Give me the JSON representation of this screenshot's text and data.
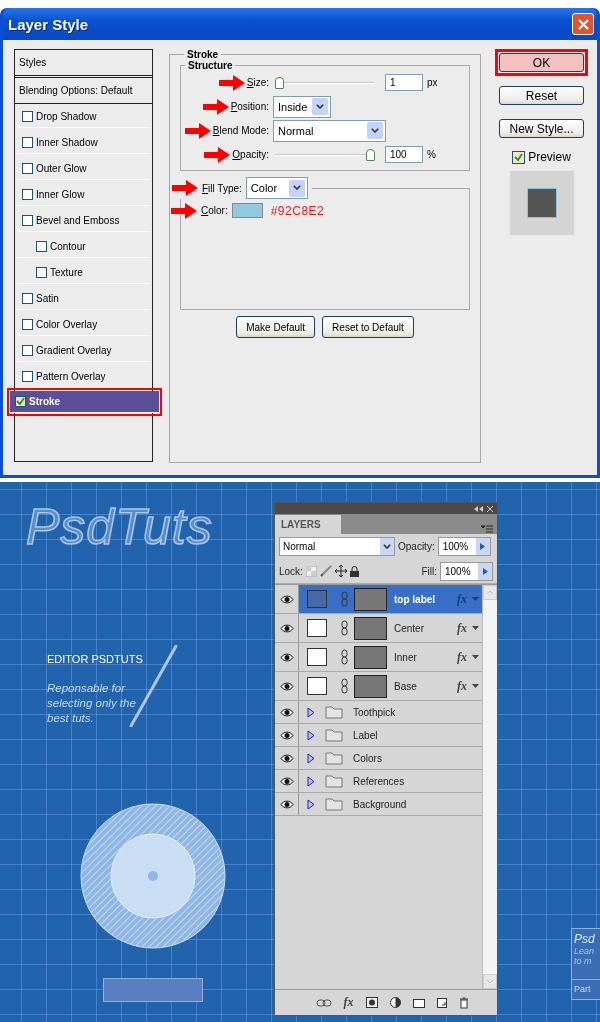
{
  "dialog": {
    "title": "Layer Style",
    "styles_header": "Styles",
    "blending": "Blending Options: Default",
    "effects": [
      {
        "label": "Drop Shadow",
        "checked": false,
        "selected": false,
        "highlighted": false
      },
      {
        "label": "Inner Shadow",
        "checked": false,
        "selected": false,
        "highlighted": false
      },
      {
        "label": "Outer Glow",
        "checked": false,
        "selected": false,
        "highlighted": false
      },
      {
        "label": "Inner Glow",
        "checked": false,
        "selected": false,
        "highlighted": false
      },
      {
        "label": "Bevel and Emboss",
        "checked": false,
        "selected": false,
        "highlighted": false,
        "children": [
          {
            "label": "Contour",
            "checked": false,
            "selected": false,
            "highlighted": false
          },
          {
            "label": "Texture",
            "checked": false,
            "selected": false,
            "highlighted": false
          }
        ]
      },
      {
        "label": "Satin",
        "checked": false,
        "selected": false,
        "highlighted": false
      },
      {
        "label": "Color Overlay",
        "checked": false,
        "selected": false,
        "highlighted": false
      },
      {
        "label": "Gradient Overlay",
        "checked": false,
        "selected": false,
        "highlighted": false
      },
      {
        "label": "Pattern Overlay",
        "checked": false,
        "selected": false,
        "highlighted": false
      },
      {
        "label": "Stroke",
        "checked": true,
        "selected": true,
        "highlighted": true
      }
    ],
    "stroke": {
      "title": "Stroke",
      "structure": "Structure",
      "size": {
        "label": "Size:",
        "value": "1",
        "unit": "px",
        "level": 0
      },
      "position": {
        "label": "Position:",
        "value": "Inside"
      },
      "blend_mode": {
        "label": "Blend Mode:",
        "value": "Normal"
      },
      "opacity": {
        "label": "Opacity:",
        "value": "100",
        "unit": "%",
        "level": 1
      },
      "fill_type": {
        "label": "Fill Type:",
        "value": "Color"
      },
      "color": {
        "label": "Color:",
        "color": "#92c8e2",
        "note": "#92C8E2"
      }
    },
    "bottom_buttons": [
      "Make Default",
      "Reset to Default"
    ],
    "side_buttons": [
      {
        "label": "OK",
        "highlighted": true
      },
      {
        "label": "Reset",
        "highlighted": false
      },
      {
        "label": "New Style...",
        "highlighted": false
      }
    ],
    "preview": {
      "label": "Preview",
      "checked": true
    }
  },
  "canvas": {
    "logo": "PsdTuts",
    "editor_title": "EDITOR PSDTUTS",
    "editor_text": "Reponsable for selecting only the best tuts.",
    "card": {
      "title": "Psd",
      "lines": [
        "Lean",
        "to m"
      ],
      "footer": "Part"
    }
  },
  "layers_panel": {
    "tab": "LAYERS",
    "blend": "Normal",
    "opacity_label": "Opacity:",
    "opacity": "100%",
    "lock_label": "Lock:",
    "fill_label": "Fill:",
    "fill": "100%",
    "layers": [
      {
        "kind": "layer",
        "name": "top label",
        "selected": true,
        "visible": true,
        "fx": "fx"
      },
      {
        "kind": "layer",
        "name": "Center",
        "selected": false,
        "visible": true,
        "fx": "fx"
      },
      {
        "kind": "layer",
        "name": "Inner",
        "selected": false,
        "visible": true,
        "fx": "fx"
      },
      {
        "kind": "layer",
        "name": "Base",
        "selected": false,
        "visible": true,
        "fx": "fx"
      },
      {
        "kind": "group",
        "name": "Toothpick",
        "selected": false,
        "visible": true
      },
      {
        "kind": "group",
        "name": "Label",
        "selected": false,
        "visible": true
      },
      {
        "kind": "group",
        "name": "Colors",
        "selected": false,
        "visible": true
      },
      {
        "kind": "group",
        "name": "References",
        "selected": false,
        "visible": true
      },
      {
        "kind": "group",
        "name": "Background",
        "selected": false,
        "visible": true
      }
    ],
    "toolbar_fx": "fx"
  }
}
